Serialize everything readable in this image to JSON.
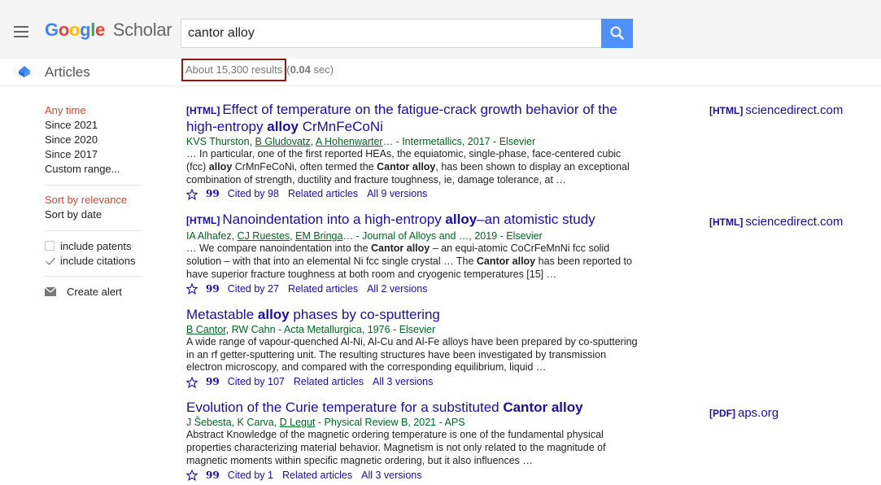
{
  "header": {
    "logo_google": "Google",
    "logo_scholar": "Scholar",
    "search_value": "cantor alloy"
  },
  "subheader": {
    "section": "Articles",
    "results_text": "About 15,300 results",
    "time_prefix": "(",
    "time_value": "0.04",
    "time_suffix": " sec)"
  },
  "sidebar": {
    "time_filters": [
      "Any time",
      "Since 2021",
      "Since 2020",
      "Since 2017",
      "Custom range..."
    ],
    "sort": [
      "Sort by relevance",
      "Sort by date"
    ],
    "include_patents": "include patents",
    "include_citations": "include citations",
    "create_alert": "Create alert"
  },
  "colors": {
    "link": "#1a0dab",
    "green": "#006621",
    "active": "#d14836",
    "search_button": "#4d90fe",
    "highlight_box": "#8b1a1a"
  },
  "results": [
    {
      "tag": "[HTML]",
      "title_pre": "Effect of temperature on the fatigue-crack growth behavior of the high-entropy ",
      "title_bold": "alloy",
      "title_post": " CrMnFeCoNi",
      "authors_plain_1": "KVS Thurston, ",
      "author_link_1": "B Gludovatz",
      "authors_plain_2": ", ",
      "author_link_2": "A Hohenwarter",
      "authors_plain_3": "… - Intermetallics, 2017 - Elsevier",
      "snip1": "… In particular, one of the first reported HEAs, the equiatomic, single-phase, face-centered cubic (fcc) ",
      "snip_b1": "alloy",
      "snip2": " CrMnFeCoNi, often termed the ",
      "snip_b2": "Cantor alloy",
      "snip3": ", has been shown to display an exceptional combination of strength, ductility and fracture toughness, ie, damage tolerance, at …",
      "cited": "Cited by 98",
      "related": "Related articles",
      "versions": "All 9 versions",
      "side_tag": "[HTML]",
      "side_domain": "sciencedirect.com"
    },
    {
      "tag": "[HTML]",
      "title_pre": "Nanoindentation into a high-entropy ",
      "title_bold": "alloy",
      "title_post": "–an atomistic study",
      "authors_plain_1": "IA Alhafez, ",
      "author_link_1": "CJ Ruestes",
      "authors_plain_2": ", ",
      "author_link_2": "EM Bringa",
      "authors_plain_3": "… - Journal of Alloys and …, 2019 - Elsevier",
      "snip1": "… We compare nanoindentation into the ",
      "snip_b1": "Cantor alloy",
      "snip2": " – an equi-atomic CoCrFeMnNi fcc solid solution – with that into an elemental Ni fcc single crystal … The ",
      "snip_b2": "Cantor alloy",
      "snip3": " has been reported to have superior fracture toughness at both room and cryogenic temperatures [15] …",
      "cited": "Cited by 27",
      "related": "Related articles",
      "versions": "All 2 versions",
      "side_tag": "[HTML]",
      "side_domain": "sciencedirect.com"
    },
    {
      "title_pre": "Metastable ",
      "title_bold": "alloy",
      "title_post": " phases by co-sputtering",
      "author_link_1": "B Cantor",
      "authors_plain_2": ", RW Cahn - Acta Metallurgica, 1976 - Elsevier",
      "snip1": "A wide range of vapour-quenched Al-Ni, Al-Cu and Al-Fe alloys have been prepared by co-sputtering in an rf getter-sputtering unit. The resulting structures have been investigated by transmission electron microscopy, and compared with the corresponding equilibrium, liquid …",
      "cited": "Cited by 107",
      "related": "Related articles",
      "versions": "All 3 versions"
    },
    {
      "title_pre": "Evolution of the Curie temperature for a substituted ",
      "title_bold": "Cantor alloy",
      "authors_plain_1": "J Šebesta, K Carva, ",
      "author_link_1": "D Legut",
      "authors_plain_2": " - Physical Review B, 2021 - APS",
      "snip1": "Abstract Knowledge of the magnetic ordering temperature is one of the fundamental physical properties characterizing material behavior. Magnetism is not only related to the magnitude of magnetic moments within specific magnetic ordering, but it also influences …",
      "cited": "Cited by 1",
      "related": "Related articles",
      "versions": "All 3 versions",
      "side_tag": "[PDF]",
      "side_domain": "aps.org"
    }
  ]
}
